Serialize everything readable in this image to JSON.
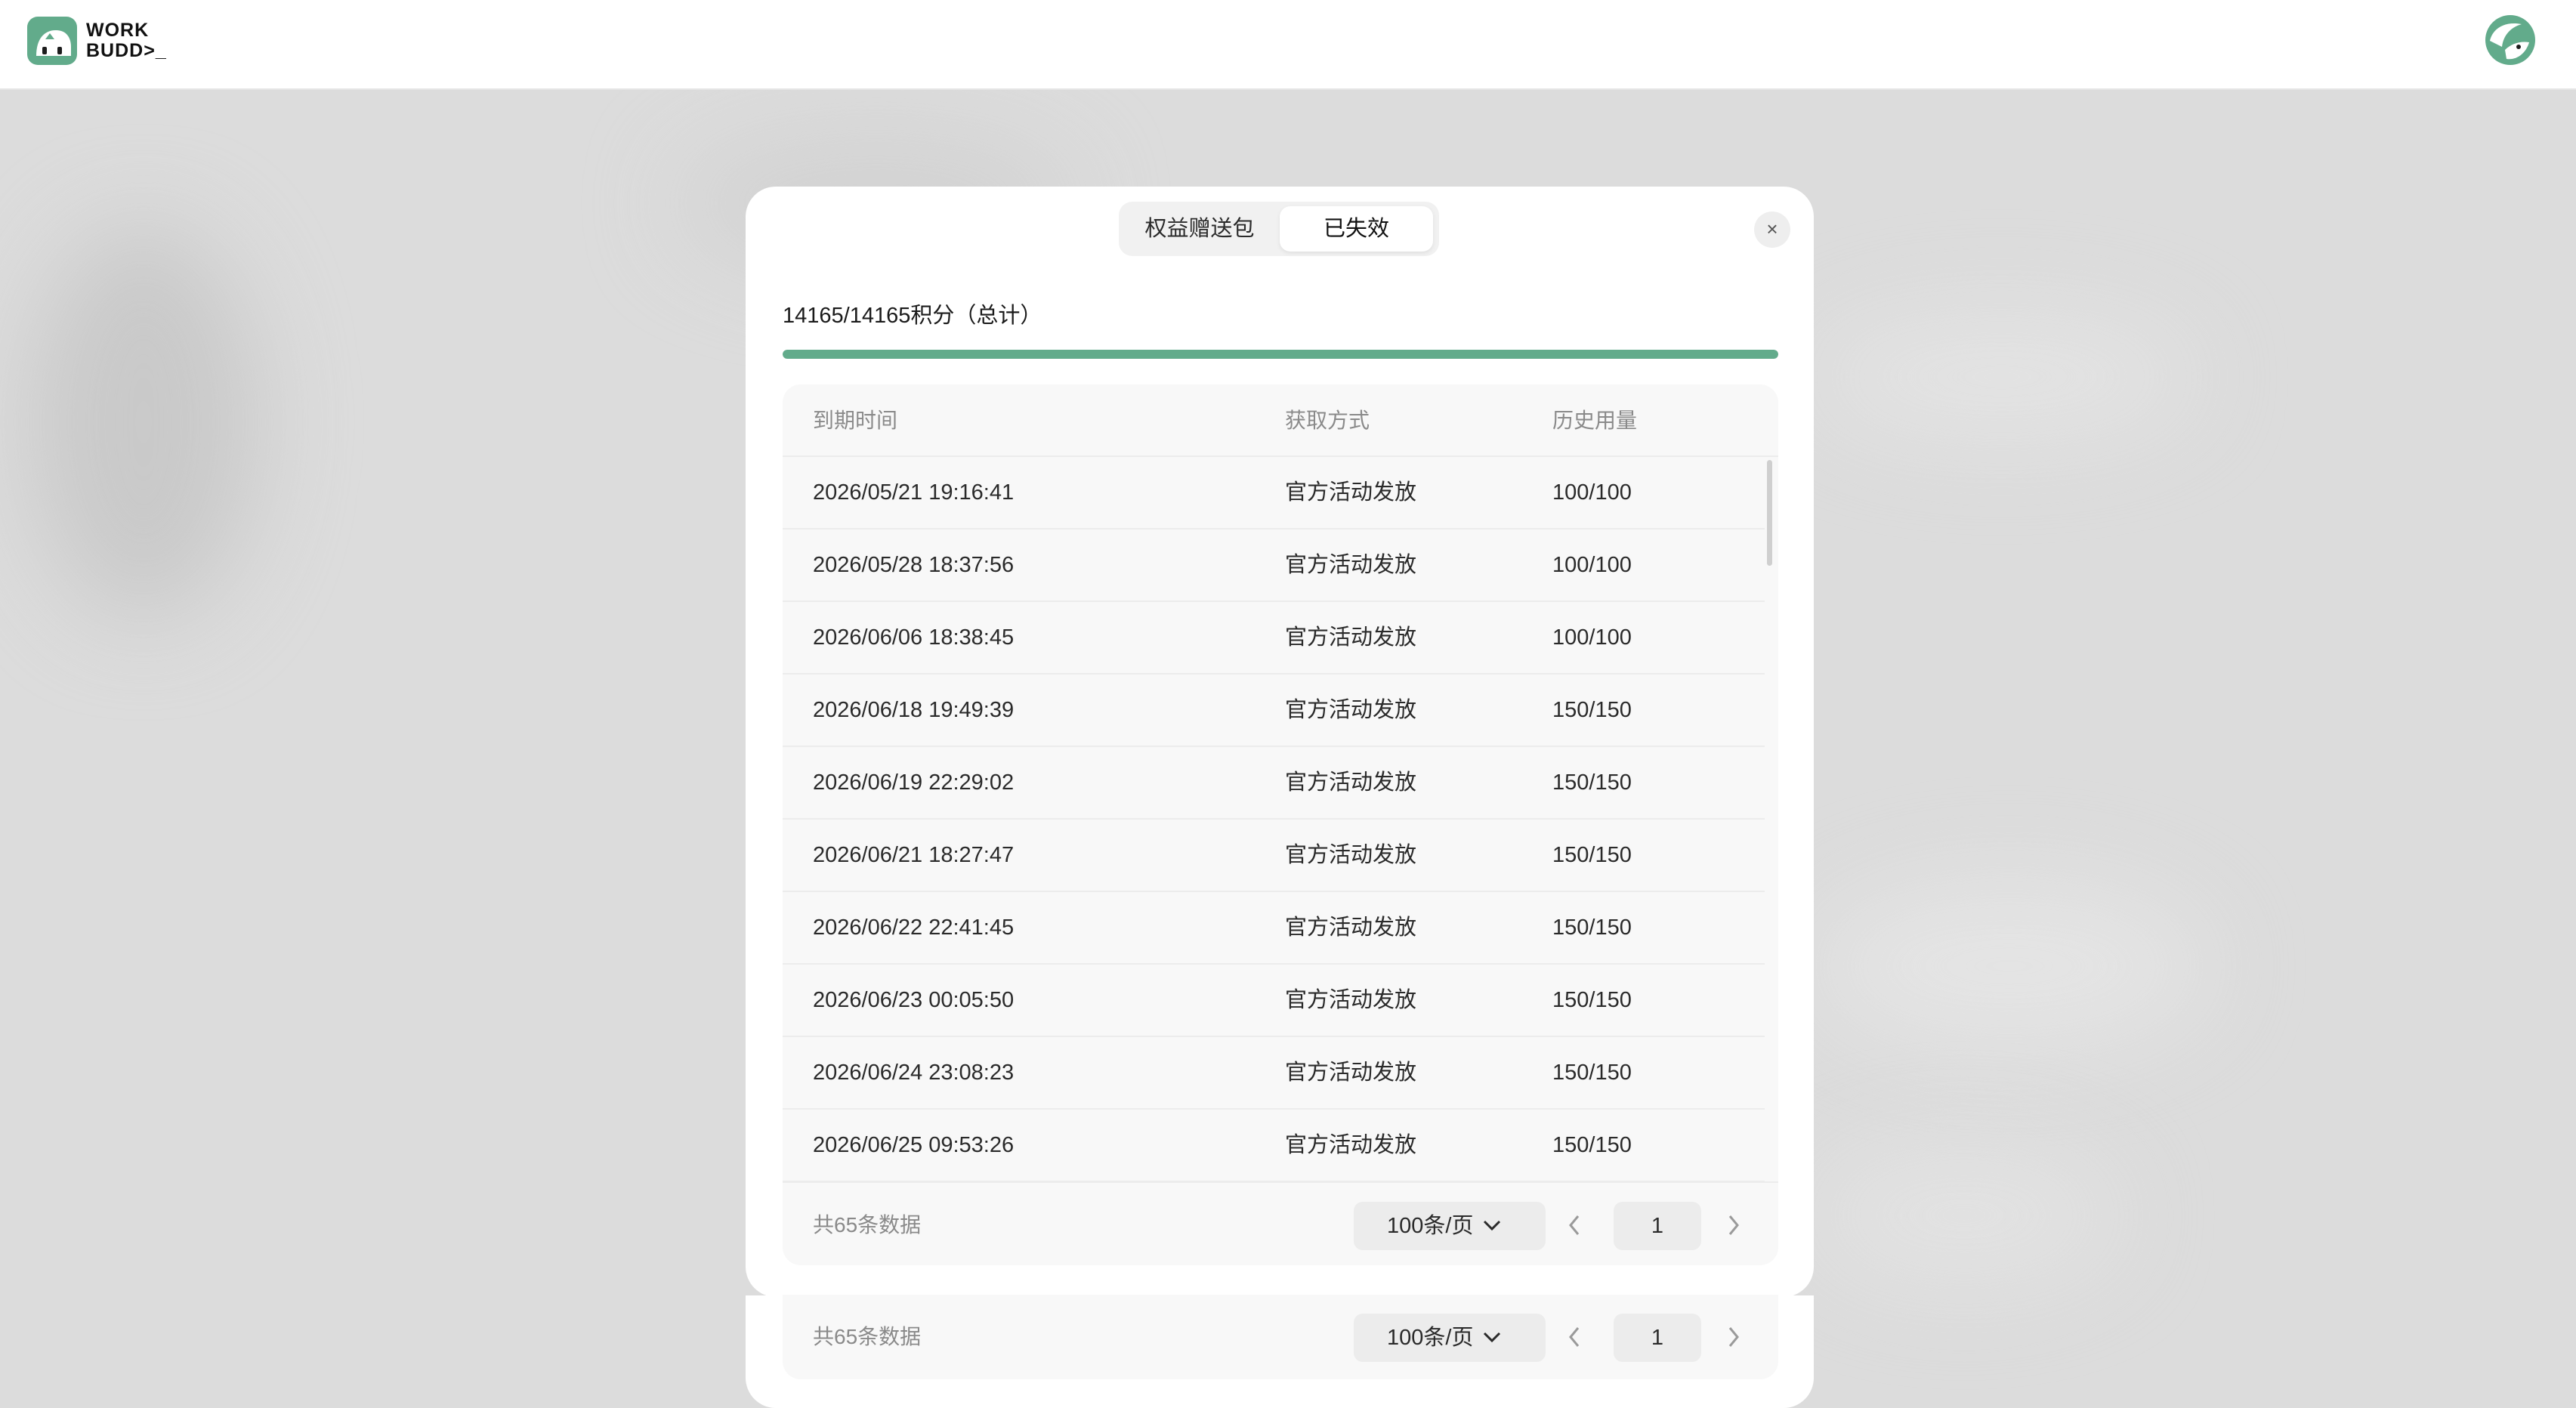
{
  "brand": {
    "name_line1": "WORK",
    "name_line2": "BUDD>_"
  },
  "tabs": [
    {
      "label": "权益赠送包",
      "active": false
    },
    {
      "label": "已失效",
      "active": true
    }
  ],
  "summary": {
    "text": "14165/14165积分（总计）",
    "progress": 1.0
  },
  "table": {
    "headers": [
      "到期时间",
      "获取方式",
      "历史用量"
    ],
    "rows": [
      [
        "2026/05/21 19:16:41",
        "官方活动发放",
        "100/100"
      ],
      [
        "2026/05/28 18:37:56",
        "官方活动发放",
        "100/100"
      ],
      [
        "2026/06/06 18:38:45",
        "官方活动发放",
        "100/100"
      ],
      [
        "2026/06/18 19:49:39",
        "官方活动发放",
        "150/150"
      ],
      [
        "2026/06/19 22:29:02",
        "官方活动发放",
        "150/150"
      ],
      [
        "2026/06/21 18:27:47",
        "官方活动发放",
        "150/150"
      ],
      [
        "2026/06/22 22:41:45",
        "官方活动发放",
        "150/150"
      ],
      [
        "2026/06/23 00:05:50",
        "官方活动发放",
        "150/150"
      ],
      [
        "2026/06/24 23:08:23",
        "官方活动发放",
        "150/150"
      ],
      [
        "2026/06/25 09:53:26",
        "官方活动发放",
        "150/150"
      ]
    ]
  },
  "pagination": {
    "total": "共65条数据",
    "page_size": "100条/页",
    "page": "1"
  },
  "icons": {
    "close": "close-icon",
    "chevron_down": "chevron-down-icon",
    "prev": "chevron-left-icon",
    "next": "chevron-right-icon"
  },
  "colors": {
    "accent": "#62ab8b",
    "modal_bg": "#ffffff",
    "backdrop": "#dcdcdc"
  }
}
